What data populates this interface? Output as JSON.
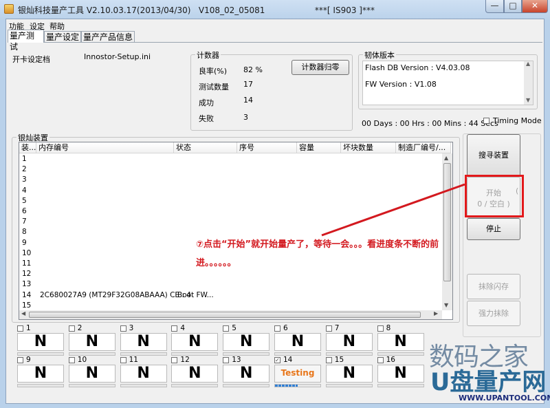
{
  "window": {
    "title": "银灿科技量产工具 V2.10.03.17(2013/04/30)   V108_02_05081                   ***[ IS903 ]***",
    "min_label": "—",
    "max_label": "□",
    "close_label": "✕"
  },
  "menu": [
    "功能",
    "设定",
    "帮助"
  ],
  "tabs": [
    "量产测试",
    "量产设定",
    "量产产品信息"
  ],
  "config": {
    "label": "开卡设定档",
    "value": "Innostor-Setup.ini"
  },
  "counter": {
    "title": "计数器",
    "reset_button": "计数器归零",
    "rows": [
      {
        "label": "良率(%)",
        "value": "82 %"
      },
      {
        "label": "测试数量",
        "value": "17"
      },
      {
        "label": "成功",
        "value": "14"
      },
      {
        "label": "失败",
        "value": "3"
      }
    ]
  },
  "firmware": {
    "title": "韧体版本",
    "flash_db": "Flash DB Version :  V4.03.08",
    "fw": "FW Version :   V1.08"
  },
  "timer": "00 Days : 00 Hrs : 00 Mins : 44 Secs",
  "timing_mode": "Timing Mode",
  "devices": {
    "title": "银灿装置",
    "columns": [
      "装...",
      "内存编号",
      "状态",
      "序号",
      "容量",
      "坏块数量",
      "制造厂编号/..."
    ],
    "rows": [
      {
        "no": "1",
        "flash": "",
        "status": ""
      },
      {
        "no": "2",
        "flash": "",
        "status": ""
      },
      {
        "no": "3",
        "flash": "",
        "status": ""
      },
      {
        "no": "4",
        "flash": "",
        "status": ""
      },
      {
        "no": "5",
        "flash": "",
        "status": ""
      },
      {
        "no": "6",
        "flash": "",
        "status": ""
      },
      {
        "no": "7",
        "flash": "",
        "status": ""
      },
      {
        "no": "8",
        "flash": "",
        "status": ""
      },
      {
        "no": "9",
        "flash": "",
        "status": ""
      },
      {
        "no": "10",
        "flash": "",
        "status": ""
      },
      {
        "no": "11",
        "flash": "",
        "status": ""
      },
      {
        "no": "12",
        "flash": "",
        "status": ""
      },
      {
        "no": "13",
        "flash": "",
        "status": ""
      },
      {
        "no": "14",
        "flash": "2C680027A9 (MT29F32G08ABAAA) CE : 4",
        "status": "Boot FW..."
      },
      {
        "no": "15",
        "flash": "",
        "status": ""
      }
    ]
  },
  "buttons": {
    "search": "搜寻装置",
    "start_line1": "开始",
    "start_line2": "0 / 空白 )",
    "start_paren": "(",
    "stop": "停止",
    "erase": "抹除闪存",
    "force_erase": "强力抹除"
  },
  "slots": [
    {
      "num": "1",
      "text": "N",
      "checked": false
    },
    {
      "num": "2",
      "text": "N",
      "checked": false
    },
    {
      "num": "3",
      "text": "N",
      "checked": false
    },
    {
      "num": "4",
      "text": "N",
      "checked": false
    },
    {
      "num": "5",
      "text": "N",
      "checked": false
    },
    {
      "num": "6",
      "text": "N",
      "checked": false
    },
    {
      "num": "7",
      "text": "N",
      "checked": false
    },
    {
      "num": "8",
      "text": "N",
      "checked": false
    },
    {
      "num": "9",
      "text": "N",
      "checked": false
    },
    {
      "num": "10",
      "text": "N",
      "checked": false
    },
    {
      "num": "11",
      "text": "N",
      "checked": false
    },
    {
      "num": "12",
      "text": "N",
      "checked": false
    },
    {
      "num": "13",
      "text": "N",
      "checked": false
    },
    {
      "num": "14",
      "text": "Testing",
      "checked": true,
      "progress": 0.5
    },
    {
      "num": "15",
      "text": "N",
      "checked": false
    },
    {
      "num": "16",
      "text": "N",
      "checked": false
    }
  ],
  "annotation": "⑦点击“开始”就开始量产了，等待一会。。。看进度条不断的前进。。。。。。",
  "annotation_color": "#d3191f",
  "watermark": {
    "line1": "数码之家",
    "line2": "U盘量产网",
    "line3": "WWW.UPANTOOL.COM"
  }
}
